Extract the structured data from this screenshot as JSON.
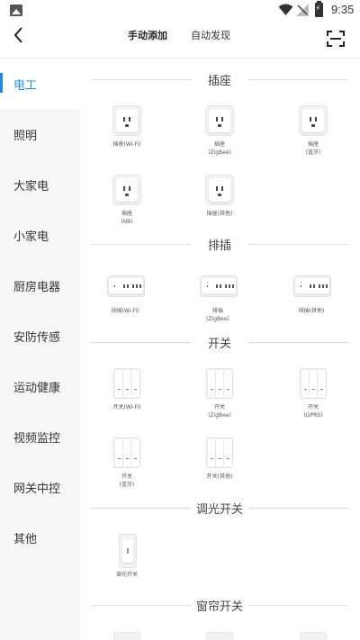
{
  "status_bar": {
    "time": "9:35"
  },
  "header": {
    "tabs": [
      {
        "label": "手动添加",
        "active": true
      },
      {
        "label": "自动发现",
        "active": false
      }
    ]
  },
  "sidebar": {
    "items": [
      {
        "label": "电工",
        "active": true
      },
      {
        "label": "照明"
      },
      {
        "label": "大家电"
      },
      {
        "label": "小家电"
      },
      {
        "label": "厨房电器"
      },
      {
        "label": "安防传感"
      },
      {
        "label": "运动健康"
      },
      {
        "label": "视频监控"
      },
      {
        "label": "网关中控"
      },
      {
        "label": "其他"
      }
    ]
  },
  "sections": [
    {
      "title": "插座",
      "devices": [
        {
          "name": "插座(Wi-Fi)"
        },
        {
          "name": "插座\n(ZigBee)"
        },
        {
          "name": "插座\n(蓝牙)"
        },
        {
          "name": "插座\n(NB)"
        },
        {
          "name": "插座(其他)"
        }
      ]
    },
    {
      "title": "排插",
      "devices": [
        {
          "name": "排插(Wi-Fi)"
        },
        {
          "name": "排插\n(ZigBee)"
        },
        {
          "name": "排插(其他)"
        }
      ]
    },
    {
      "title": "开关",
      "devices": [
        {
          "name": "开关(Wi-Fi)"
        },
        {
          "name": "开关\n(ZigBee)"
        },
        {
          "name": "开关\n(GPRS)"
        },
        {
          "name": "开关\n(蓝牙)"
        },
        {
          "name": "开关(其他)"
        }
      ]
    },
    {
      "title": "调光开关",
      "devices": [
        {
          "name": "调光开关"
        }
      ]
    },
    {
      "title": "窗帘开关",
      "devices": []
    }
  ],
  "colors": {
    "accent": "#1e88e5",
    "sidebar_bg": "#f6f6f6"
  }
}
